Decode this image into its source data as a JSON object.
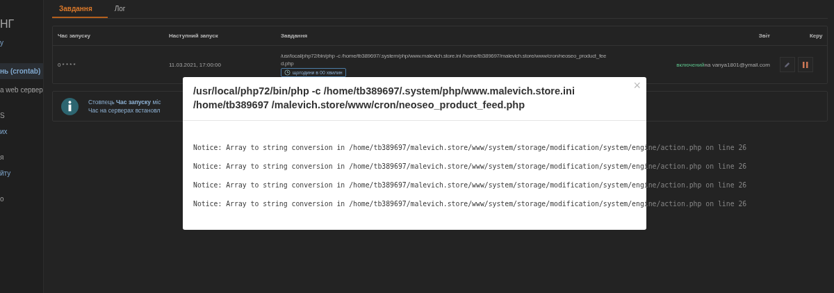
{
  "sidebar": {
    "sections": [
      {
        "items": [
          {
            "kind": "title",
            "label": "НГ",
            "selected": false
          },
          {
            "kind": "link",
            "label": "у",
            "selected": false
          }
        ]
      },
      {
        "items": [
          {
            "kind": "link",
            "label": "нь (crontab)",
            "selected": true
          },
          {
            "kind": "text",
            "label": "а web сервер",
            "selected": false
          }
        ]
      },
      {
        "items": [
          {
            "kind": "text",
            "label": "S",
            "selected": false
          },
          {
            "kind": "link",
            "label": "их",
            "selected": false
          }
        ]
      },
      {
        "items": [
          {
            "kind": "text",
            "label": "я",
            "selected": false
          },
          {
            "kind": "link",
            "label": "йту",
            "selected": false
          }
        ]
      },
      {
        "items": [
          {
            "kind": "text",
            "label": "о",
            "selected": false
          }
        ]
      }
    ]
  },
  "tabs": [
    {
      "label": "Завдання",
      "selected": true
    },
    {
      "label": "Лог",
      "selected": false
    }
  ],
  "table": {
    "columns": [
      "Час запуску",
      "Наступний запуск",
      "Завдання",
      "Звіт",
      "Керу"
    ],
    "rows": [
      {
        "schedule": "0 * * * *",
        "next_run": "11.03.2021, 17:00:00",
        "command_lines": [
          "/usr/local/php72/bin/php -c /home/tb389697/.system/php/www.malevich.store.ini /home/tb389697/malevich.store/www/cron/neoseo_product_fee",
          "d.php"
        ],
        "frequency": "щогодини в 00 хвилин",
        "report_status": "включений",
        "report_target": "на vanya1801@ymail.com"
      }
    ]
  },
  "info": {
    "lines": [
      "Стовпець **Час запуску** міс",
      "Час на серверах встановл"
    ]
  },
  "dialog": {
    "title": "/usr/local/php72/bin/php -c /home/tb389697/.system/php/www.malevich.store.ini /home/tb389697 /malevich.store/www/cron/neoseo_product_feed.php",
    "close": "×",
    "log_lines": [
      "Notice: Array to string conversion in /home/tb389697/malevich.store/www/system/storage/modification/system/engine/action.php on line 26",
      "Notice: Array to string conversion in /home/tb389697/malevich.store/www/system/storage/modification/system/engine/action.php on line 26",
      "Notice: Array to string conversion in /home/tb389697/malevich.store/www/system/storage/modification/system/engine/action.php on line 26",
      "Notice: Array to string conversion in /home/tb389697/malevich.store/www/system/storage/modification/system/engine/action.php on line 26"
    ]
  }
}
